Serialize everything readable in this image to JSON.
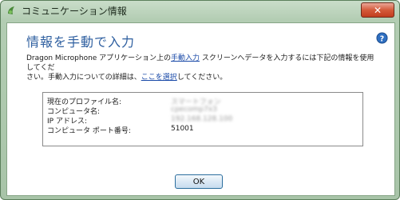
{
  "window": {
    "title": "コミュニケーション情報",
    "close_label": "✕"
  },
  "content": {
    "heading": "情報を手動で入力",
    "description": {
      "part1": "Dragon Microphone アプリケーション上の",
      "link1": "手動入力",
      "part2": " スクリーンへデータを入力するには下記の情報を使用してくだ",
      "part3": "さい。手動入力についての詳細は、",
      "link2": "ここを選択",
      "part4": "してください。"
    }
  },
  "info": {
    "rows": [
      {
        "label": "現在のプロファイル名:",
        "value": "スマートフォン"
      },
      {
        "label": "コンピュータ名:",
        "value": "cpecomp7x3"
      },
      {
        "label": "IP アドレス:",
        "value": "192.168.128.100"
      },
      {
        "label": "コンピュータ  ポート番号:",
        "value": "51001"
      }
    ]
  },
  "buttons": {
    "ok_label": "OK"
  },
  "colors": {
    "titlebar": "#b3cdb3",
    "heading": "#2e5fa0",
    "link": "#1a4aa8",
    "close": "#c23d1f"
  },
  "icons": {
    "app": "app-icon",
    "help": "help-icon",
    "close": "close-icon"
  }
}
